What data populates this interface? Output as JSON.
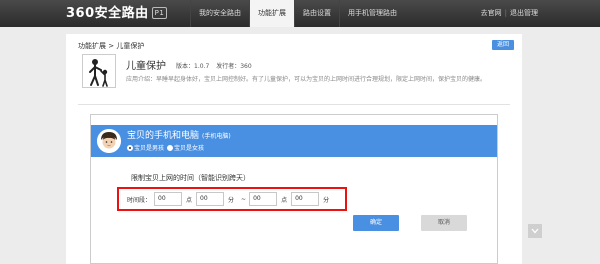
{
  "header": {
    "logo_text": "360安全路由",
    "logo_badge": "P1",
    "nav": [
      {
        "label": "我的安全路由",
        "active": false
      },
      {
        "label": "功能扩展",
        "active": true
      },
      {
        "label": "路由设置",
        "active": false
      },
      {
        "label": "用手机管理路由",
        "active": false
      }
    ],
    "links": {
      "official_site": "去官网",
      "separator": "|",
      "logout": "退出管理"
    }
  },
  "page": {
    "breadcrumb": "功能扩展 > 儿童保护",
    "back_label": "返回"
  },
  "app": {
    "icon": "child-protection-icon",
    "name": "儿童保护",
    "version": "版本：1.0.7",
    "publisher": "发行者：360",
    "description": "应用介绍：早睡早起身体好，宝贝上网控制好。有了儿童保护，可以为宝贝的上网时间进行合理规划，限定上网时间，保护宝贝的健康。"
  },
  "device": {
    "name": "宝贝的手机和电脑",
    "type": "(手机电脑)",
    "options": [
      {
        "label": "宝贝是男孩",
        "selected": true
      },
      {
        "label": "宝贝是女孩",
        "selected": false
      }
    ]
  },
  "limit": {
    "title": "限制宝贝上网的时间（智能识别跨天）",
    "time_label": "时间段：",
    "start_hour": "00",
    "start_minute": "00",
    "end_hour": "00",
    "end_minute": "00",
    "hour_unit": "点",
    "minute_unit": "分",
    "tilde": "~"
  },
  "actions": {
    "confirm": "确定",
    "cancel": "取消"
  },
  "colors": {
    "accent": "#4a90e2",
    "highlight_border": "#e11111",
    "topbar": "#2b2b2b"
  }
}
